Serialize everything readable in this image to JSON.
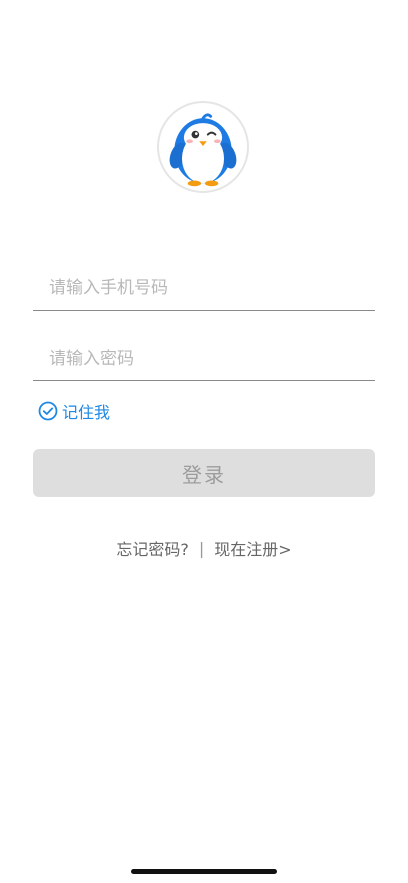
{
  "logo": {
    "icon": "penguin-mascot-icon"
  },
  "form": {
    "phone_placeholder": "请输入手机号码",
    "password_placeholder": "请输入密码",
    "remember_label": "记住我",
    "login_label": "登录"
  },
  "links": {
    "forgot": "忘记密码?",
    "separator": "|",
    "register": "现在注册>"
  },
  "colors": {
    "accent": "#1e88e5",
    "button_bg": "#dedede",
    "button_text": "#9c9c9c"
  }
}
